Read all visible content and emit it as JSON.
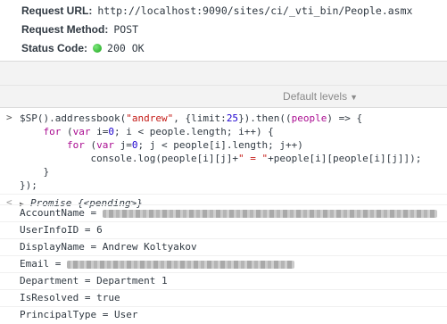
{
  "request": {
    "url_label": "Request URL:",
    "url_value": "http://localhost:9090/sites/ci/_vti_bin/People.asmx",
    "method_label": "Request Method:",
    "method_value": "POST",
    "status_label": "Status Code:",
    "status_value": "200 OK",
    "status_color": "#1aa31a"
  },
  "console_toolbar": {
    "levels_label": "Default levels",
    "levels_icon": "triangle-down-icon"
  },
  "console_input": {
    "prompt": ">",
    "lines": [
      "$SP().addressbook(\"andrew\", {limit:25}).then((people) => {",
      "    for (var i=0; i < people.length; i++) {",
      "        for (var j=0; j < people[i].length; j++)",
      "            console.log(people[i][j]+\" = \"+people[i][people[i][j]]);",
      "    }",
      "});"
    ]
  },
  "console_output": {
    "return_icon": "<",
    "promise_label": "Promise {<pending>}",
    "logs": [
      {
        "key": "AccountName = ",
        "value": "",
        "redacted": true
      },
      {
        "key": "UserInfoID = 6",
        "value": "",
        "redacted": false
      },
      {
        "key": "DisplayName = Andrew Koltyakov",
        "value": "",
        "redacted": false
      },
      {
        "key": "Email = ",
        "value": "",
        "redacted": true
      },
      {
        "key": "Department = Department 1",
        "value": "",
        "redacted": false
      },
      {
        "key": "IsResolved = true",
        "value": "",
        "redacted": false
      },
      {
        "key": "PrincipalType = User",
        "value": "",
        "redacted": false
      }
    ]
  }
}
